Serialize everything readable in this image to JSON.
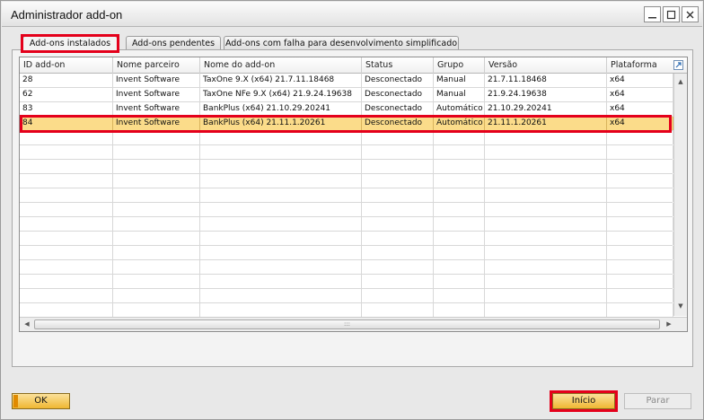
{
  "window": {
    "title": "Administrador add-on"
  },
  "window_controls": {
    "minimize": "—",
    "maximize": "☐",
    "close": "✕"
  },
  "tabs": [
    {
      "label": "Add-ons instalados",
      "active": true
    },
    {
      "label": "Add-ons pendentes",
      "active": false
    },
    {
      "label": "Add-ons com falha para desenvolvimento simplificado",
      "active": false
    }
  ],
  "table": {
    "columns": [
      "ID add-on",
      "Nome parceiro",
      "Nome do add-on",
      "Status",
      "Grupo",
      "Versão",
      "Plataforma"
    ],
    "rows": [
      {
        "cells": [
          "28",
          "Invent Software",
          "TaxOne 9.X (x64) 21.7.11.18468",
          "Desconectado",
          "Manual",
          "21.7.11.18468",
          "x64"
        ],
        "selected": false
      },
      {
        "cells": [
          "62",
          "Invent Software",
          "TaxOne NFe 9.X (x64) 21.9.24.19638",
          "Desconectado",
          "Manual",
          "21.9.24.19638",
          "x64"
        ],
        "selected": false
      },
      {
        "cells": [
          "83",
          "Invent Software",
          "BankPlus (x64) 21.10.29.20241",
          "Desconectado",
          "Automático",
          "21.10.29.20241",
          "x64"
        ],
        "selected": false
      },
      {
        "cells": [
          "84",
          "Invent Software",
          "BankPlus (x64) 21.11.1.20261",
          "Desconectado",
          "Automático",
          "21.11.1.20261",
          "x64"
        ],
        "selected": true
      }
    ],
    "hscroll_grip": ":::"
  },
  "buttons": {
    "ok": "OK",
    "start": "Início",
    "stop": "Parar"
  },
  "colors": {
    "highlight": "#e4001b",
    "selected_row": "#fbdc8a",
    "gold_button": "#efb732"
  }
}
